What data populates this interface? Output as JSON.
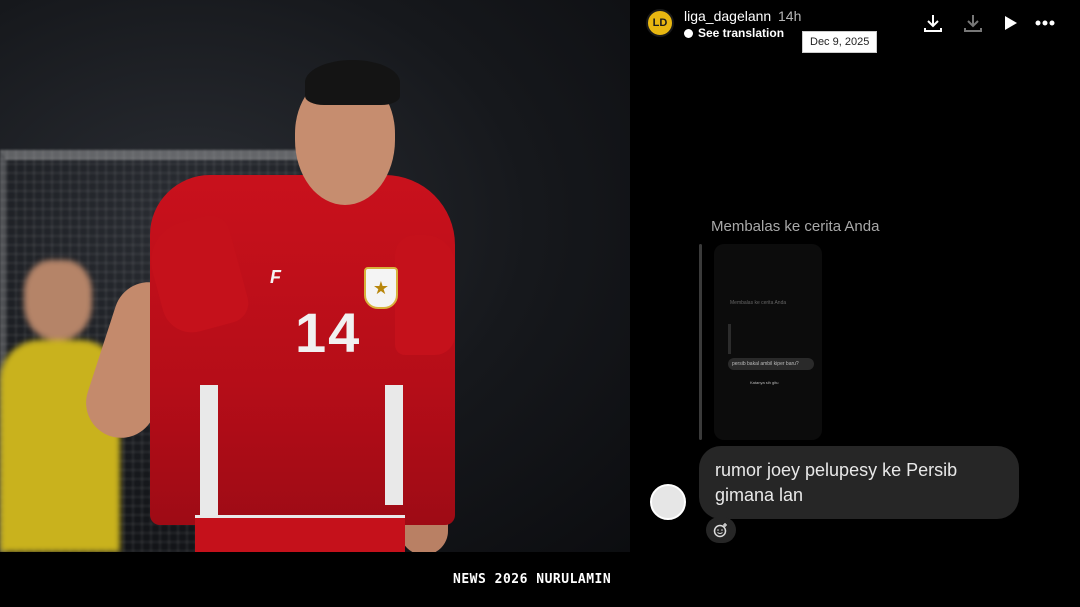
{
  "photo": {
    "jersey_number": "14",
    "brand_mark": "F"
  },
  "story": {
    "username": "liga_dagelann",
    "avatar_text": "LD",
    "time_ago": "14h",
    "see_translation": "See translation",
    "date_tooltip": "Dec 9, 2025",
    "icons": [
      "download-icon",
      "save-icon",
      "play-icon",
      "more-icon"
    ],
    "reply_label": "Membalas ke cerita Anda",
    "reply_preview": {
      "label": "Membalas ke cerita Anda",
      "message": "persib bakal ambil kiper baru?",
      "caption": "Katanya sih gitu"
    },
    "message": "rumor joey pelupesy  ke Persib gimana lan",
    "react_icon": "add-reaction-icon"
  },
  "footer": {
    "watermark": "NEWS 2026 NURULAMIN"
  },
  "colors": {
    "jersey_red": "#c9111c",
    "bubble_bg": "#262626",
    "avatar_yellow": "#e8b711"
  }
}
